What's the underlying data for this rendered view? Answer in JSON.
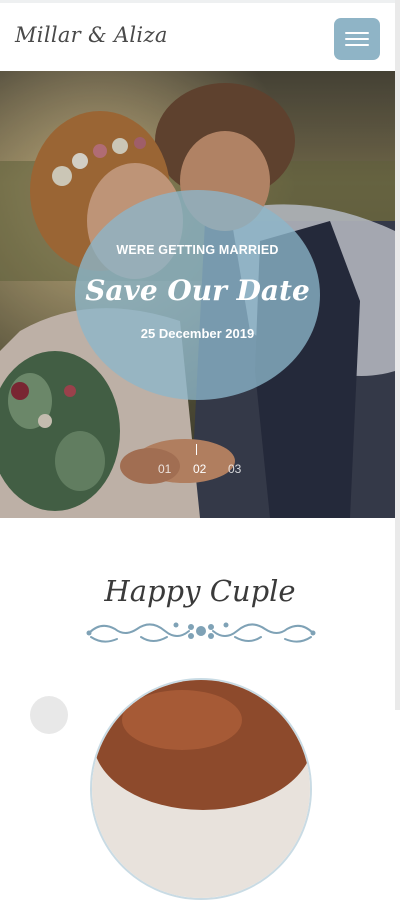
{
  "header": {
    "logo_text": "Millar & Aliza",
    "menu_icon": "hamburger-menu-icon",
    "menu_color": "#8fb4c6"
  },
  "hero": {
    "subtitle": "WERE GETTING MARRIED",
    "title": "Save Our Date",
    "date": "25 December 2019",
    "circle_color": "#8cb6cb",
    "slides": [
      "01",
      "02",
      "03"
    ],
    "active_slide": "02"
  },
  "couple_section": {
    "title": "Happy Cuple",
    "ornament_icon": "floral-divider-icon",
    "accent_color": "#7fa2b6"
  }
}
